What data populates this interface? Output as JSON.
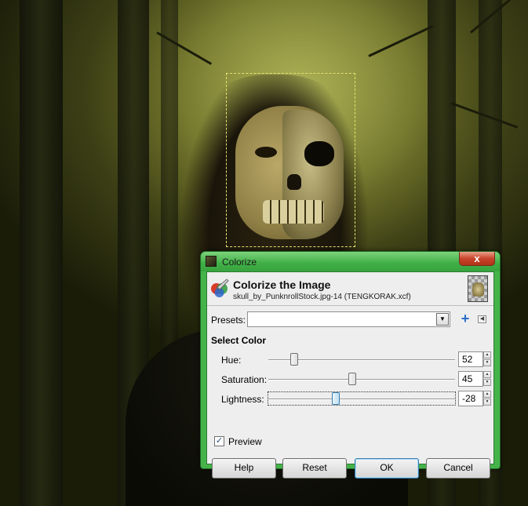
{
  "window": {
    "title": "Colorize",
    "close_symbol": "x"
  },
  "header": {
    "title": "Colorize the Image",
    "subtitle": "skull_by_PunknrollStock.jpg-14 (TENGKORAK.xcf)"
  },
  "presets": {
    "label": "Presets:",
    "value": ""
  },
  "section": {
    "title": "Select Color"
  },
  "fields": [
    {
      "label": "Hue:",
      "value": "52",
      "level": 0.14
    },
    {
      "label": "Saturation:",
      "value": "45",
      "level": 0.45
    },
    {
      "label": "Lightness:",
      "value": "-28",
      "level": 0.36
    }
  ],
  "preview": {
    "label": "Preview",
    "checked": true
  },
  "buttons": {
    "help": "Help",
    "reset": "Reset",
    "ok": "OK",
    "cancel": "Cancel"
  },
  "icons": {
    "app": "gimp-icon",
    "header": "colorize-icon",
    "thumbnail": "layer-thumbnail",
    "add": "plus-icon",
    "menu": "menu-arrow-icon",
    "combo": "dropdown-arrow-icon"
  },
  "colors": {
    "titlebar": "#45b34a",
    "plus": "#2a6fc9",
    "focus": "#3c7fb1"
  }
}
